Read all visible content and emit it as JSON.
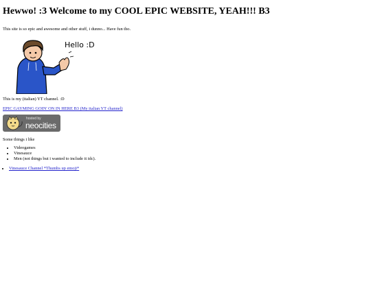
{
  "page": {
    "title": "Hewwo! :3 Welcome to my COOL EPIC WEBSITE, YEAH!!! B3",
    "intro": "This site is so epic and awesome and other stuff, i dunno... Have fun tho."
  },
  "drawing": {
    "speech": "Hello :D",
    "hoodie_color": "#2a55c8"
  },
  "youtube": {
    "text": "This is my (italian) YT channel. :D",
    "link_label": "EPIC GAYMING GOIN' ON IN HERE B3 (My italian YT channel)"
  },
  "badge": {
    "hosted_by": "hosted by",
    "brand": "neocities"
  },
  "likes": {
    "title": "Some things i like",
    "items": [
      "Videogames",
      "Vinesauce",
      "Men (not things but i wanted to include it idc)."
    ]
  },
  "links": [
    "Vinesauce Channel *Thumbs up emoji*"
  ],
  "colors": {
    "link": "#2222cc",
    "background": "#ffffff"
  }
}
